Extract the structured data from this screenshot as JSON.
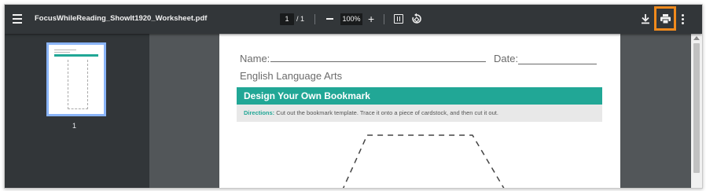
{
  "toolbar": {
    "title": "FocusWhileReading_ShowIt1920_Worksheet.pdf",
    "current_page": "1",
    "page_total": "/ 1",
    "zoom_level": "100%",
    "zoom_out": "–",
    "zoom_in": "+",
    "icons": [
      "menu-icon",
      "fit-page-icon",
      "rotate-icon",
      "download-icon",
      "print-icon",
      "more-options-icon"
    ],
    "highlight_color": "#f08a1c"
  },
  "sidebar": {
    "thumbnail_page_number": "1"
  },
  "document": {
    "name_label": "Name:",
    "date_label": "Date:",
    "subject": "English Language Arts",
    "banner": "Design Your Own Bookmark",
    "directions_label": "Directions:",
    "directions_text": " Cut out the bookmark template. Trace it onto a piece of cardstock, and then cut it out.",
    "accent_color": "#21a796"
  }
}
